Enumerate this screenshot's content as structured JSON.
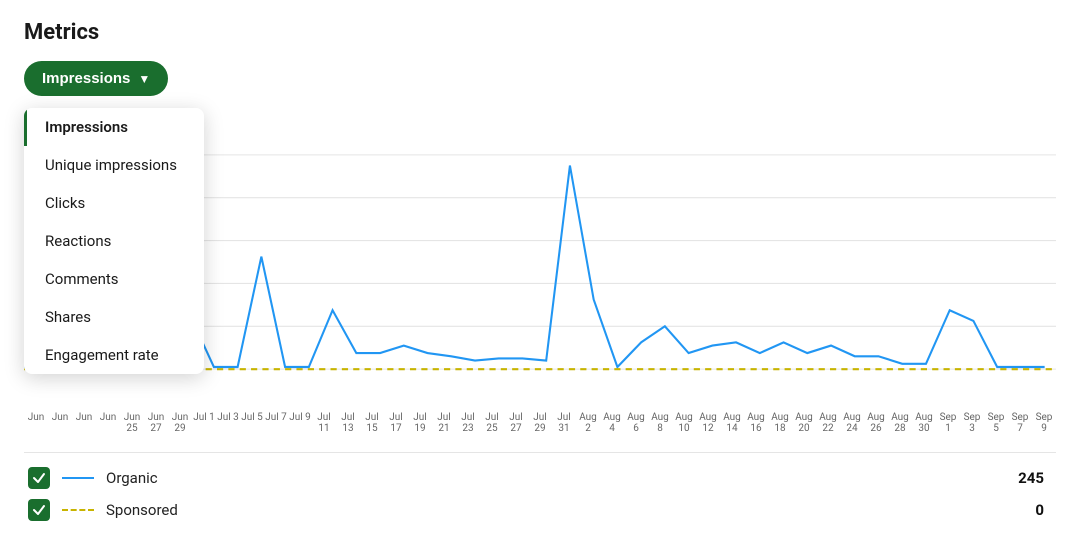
{
  "page": {
    "title": "Metrics"
  },
  "dropdown": {
    "label": "Impressions",
    "arrow": "▼",
    "items": [
      {
        "id": "impressions",
        "label": "Impressions",
        "active": true
      },
      {
        "id": "unique-impressions",
        "label": "Unique impressions",
        "active": false
      },
      {
        "id": "clicks",
        "label": "Clicks",
        "active": false
      },
      {
        "id": "reactions",
        "label": "Reactions",
        "active": false
      },
      {
        "id": "comments",
        "label": "Comments",
        "active": false
      },
      {
        "id": "shares",
        "label": "Shares",
        "active": false
      },
      {
        "id": "engagement-rate",
        "label": "Engagement rate",
        "active": false
      }
    ]
  },
  "legend": {
    "organic": {
      "label": "Organic",
      "value": "245"
    },
    "sponsored": {
      "label": "Sponsored",
      "value": "0"
    }
  },
  "xAxisLabels": [
    "Jun",
    "Jun",
    "Jun",
    "Jun",
    "Jun 25",
    "Jun 27",
    "Jun 29",
    "Jul 1",
    "Jul 3",
    "Jul 5",
    "Jul 7",
    "Jul 9",
    "Jul 11",
    "Jul 13",
    "Jul 15",
    "Jul 17",
    "Jul 19",
    "Jul 21",
    "Jul 23",
    "Jul 25",
    "Jul 27",
    "Jul 29",
    "Jul 31",
    "Aug 2",
    "Aug 4",
    "Aug 6",
    "Aug 8",
    "Aug 10",
    "Aug 12",
    "Aug 14",
    "Aug 16",
    "Aug 18",
    "Aug 20",
    "Aug 22",
    "Aug 24",
    "Aug 26",
    "Aug 28",
    "Aug 30",
    "Sep 1",
    "Sep 3",
    "Sep 5",
    "Sep 7",
    "Sep 9"
  ]
}
